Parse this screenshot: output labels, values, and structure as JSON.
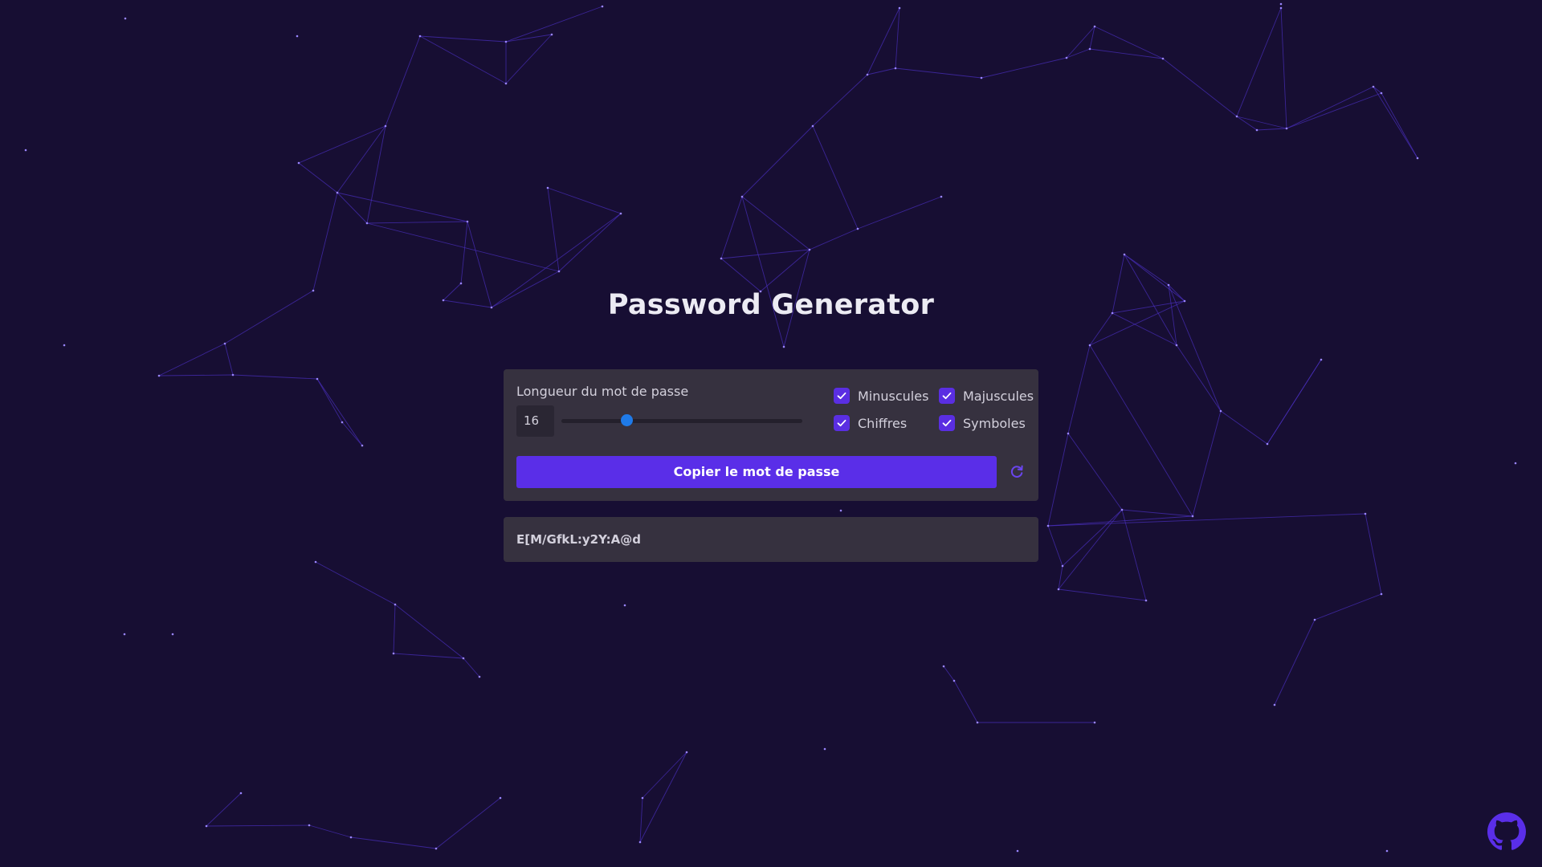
{
  "header": {
    "title": "Password Generator"
  },
  "settings": {
    "length_label": "Longueur du mot de passe",
    "length_value": "16",
    "length_fraction": 0.27,
    "options": [
      {
        "label": "Minuscules",
        "checked": true
      },
      {
        "label": "Majuscules",
        "checked": true
      },
      {
        "label": "Chiffres",
        "checked": true
      },
      {
        "label": "Symboles",
        "checked": true
      }
    ]
  },
  "actions": {
    "copy_label": "Copier le mot de passe",
    "refresh_icon": "refresh-icon"
  },
  "output": {
    "password": "E[M/GfkL:y2Y:A@d"
  },
  "footer": {
    "github_icon": "github-icon"
  },
  "colors": {
    "background": "#170e33",
    "panel": "#36313f",
    "accent": "#5a2ee8",
    "slider_thumb": "#1f7ae8",
    "network_lines": "#4a2fbf"
  }
}
